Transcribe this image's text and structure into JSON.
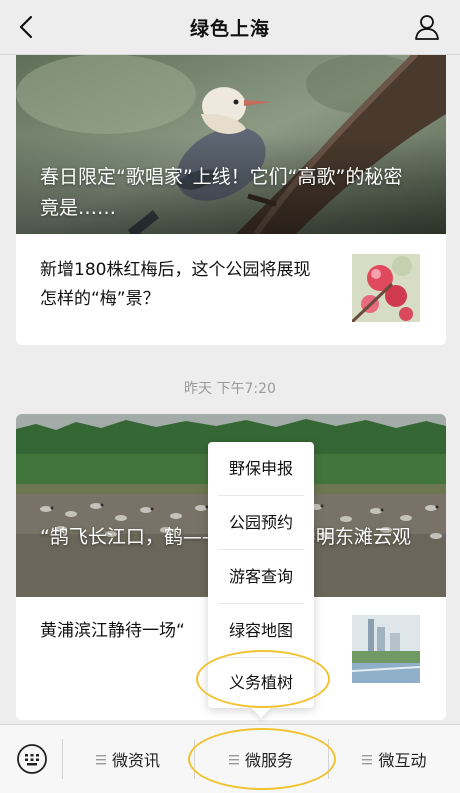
{
  "header": {
    "title": "绿色上海",
    "back_icon": "chevron-left-icon",
    "profile_icon": "person-icon"
  },
  "articles": [
    {
      "hero_title": "春日限定“歌唱家”上线！它们“高歌”的秘密竟是……",
      "sub_item": {
        "title": "新增180株红梅后，这个公园将展现怎样的“梅”景？"
      }
    },
    {
      "hero_title": "“鹄飞长江口，鹤——本周六，崇明东滩云观",
      "sub_item": {
        "title": "黄浦滨江静待一场“"
      }
    }
  ],
  "timestamp": "昨天 下午7:20",
  "popup_menu": {
    "items": [
      "野保申报",
      "公园预约",
      "游客查询",
      "绿容地图",
      "义务植树"
    ]
  },
  "tabbar": {
    "keyboard_icon": "keyboard-icon",
    "tabs": [
      "微资讯",
      "微服务",
      "微互动"
    ]
  },
  "highlight_color": "#f2c230"
}
